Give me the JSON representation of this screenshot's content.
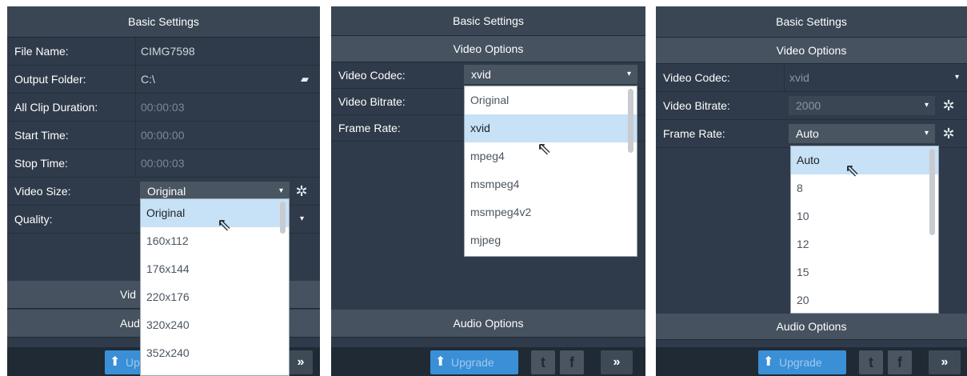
{
  "panel1": {
    "header": "Basic Settings",
    "rows": [
      {
        "label": "File Name:",
        "value": "CIMG7598"
      },
      {
        "label": "Output Folder:",
        "value": "C:\\"
      },
      {
        "label": "All Clip Duration:",
        "value": "00:00:03"
      },
      {
        "label": "Start Time:",
        "value": "00:00:00"
      },
      {
        "label": "Stop Time:",
        "value": "00:00:03"
      }
    ],
    "video_size": {
      "label": "Video Size:",
      "value": "Original"
    },
    "quality_label": "Quality:",
    "video_header_partial": "Vid",
    "audio_header_partial": "Aud",
    "dropdown": [
      "Original",
      "160x112",
      "176x144",
      "220x176",
      "320x240",
      "352x240"
    ],
    "upgrade_partial": "Upgrade"
  },
  "panel2": {
    "header": "Basic Settings",
    "subheader": "Video Options",
    "video_codec": {
      "label": "Video Codec:",
      "value": "xvid"
    },
    "video_bitrate_label": "Video Bitrate:",
    "frame_rate_label": "Frame Rate:",
    "dropdown": [
      "Original",
      "xvid",
      "mpeg4",
      "msmpeg4",
      "msmpeg4v2",
      "mjpeg"
    ],
    "audio_header": "Audio Options",
    "upgrade": "Upgrade"
  },
  "panel3": {
    "header": "Basic Settings",
    "subheader": "Video Options",
    "video_codec": {
      "label": "Video Codec:",
      "value": "xvid"
    },
    "video_bitrate": {
      "label": "Video Bitrate:",
      "value": "2000"
    },
    "frame_rate": {
      "label": "Frame Rate:",
      "value": "Auto"
    },
    "dropdown": [
      "Auto",
      "8",
      "10",
      "12",
      "15",
      "20"
    ],
    "audio_header": "Audio Options",
    "upgrade": "Upgrade"
  },
  "icons": {
    "dropdown": "▾",
    "gear": "✲",
    "folder": "▰",
    "upgrade": "⬆",
    "twitter": "t",
    "facebook": "f",
    "forward": "»",
    "cursor": "⇖"
  },
  "colors": {
    "panel": "#2f3b4a",
    "header": "#3a4654",
    "accent": "#3a8fd6",
    "selected_option": "#c7e1f6"
  }
}
